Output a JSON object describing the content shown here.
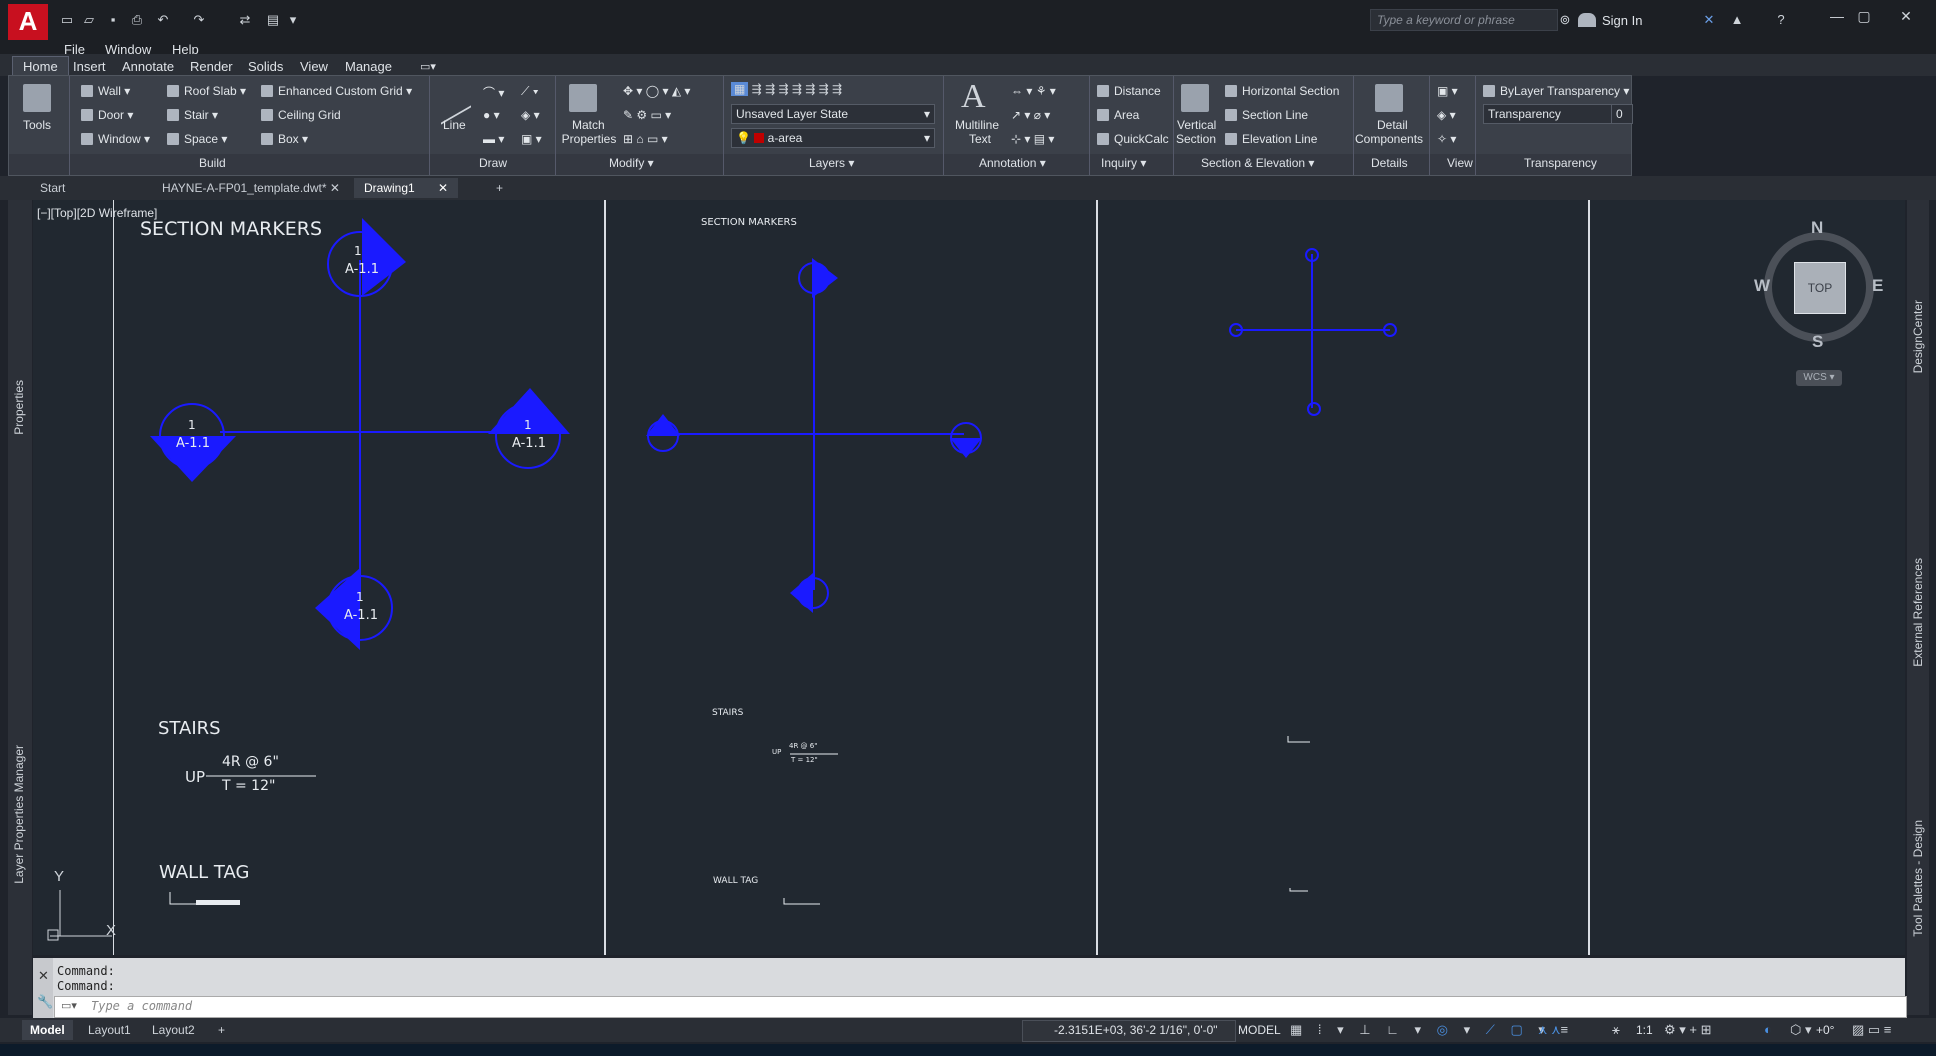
{
  "app": {
    "logo_letter": "A"
  },
  "search": {
    "placeholder": "Type a keyword or phrase"
  },
  "sign_in": "Sign In",
  "menus": [
    "File",
    "Window",
    "Help"
  ],
  "ribbon_tabs": [
    "Home",
    "Insert",
    "Annotate",
    "Render",
    "Solids",
    "View",
    "Manage"
  ],
  "ribbon": {
    "tools": "Tools",
    "build": {
      "title": "Build",
      "items": [
        "Wall",
        "Door",
        "Window",
        "Roof Slab",
        "Stair",
        "Space",
        "Enhanced Custom Grid",
        "Ceiling Grid",
        "Box"
      ]
    },
    "draw": {
      "title": "Draw",
      "line": "Line"
    },
    "modify": {
      "title": "Modify",
      "match": "Match",
      "properties": "Properties"
    },
    "layers": {
      "title": "Layers",
      "layer_state": "Unsaved Layer State",
      "current_layer": "a-area"
    },
    "annotation": {
      "title": "Annotation",
      "multiline": "Multiline",
      "text": "Text"
    },
    "inquiry": {
      "title": "Inquiry",
      "items": [
        "Distance",
        "Area",
        "QuickCalc"
      ]
    },
    "section": {
      "title": "Section & Elevation",
      "vertical": "Vertical",
      "section": "Section",
      "items": [
        "Horizontal Section",
        "Section Line",
        "Elevation Line"
      ]
    },
    "details": {
      "title": "Details",
      "detail": "Detail",
      "components": "Components"
    },
    "view": {
      "title": "View"
    },
    "transparency": {
      "title": "Transparency",
      "bylayer": "ByLayer Transparency",
      "label": "Transparency",
      "value": "0"
    }
  },
  "file_tabs": [
    "Start",
    "HAYNE-A-FP01_template.dwt*",
    "Drawing1"
  ],
  "viewport_label": "[−][Top][2D Wireframe]",
  "side_palettes": {
    "left": [
      "Properties",
      "Layer Properties Manager"
    ],
    "right": [
      "DesignCenter",
      "External References",
      "Tool Palettes - Design"
    ]
  },
  "drawing": {
    "section_markers": "SECTION MARKERS",
    "marker_num": "1",
    "marker_sheet": "A-1.1",
    "stairs": "STAIRS",
    "stair_up": "UP",
    "stair_riser": "4R @ 6\"",
    "stair_tread": "T = 12\"",
    "wall_tag": "WALL TAG"
  },
  "viewcube": {
    "n": "N",
    "s": "S",
    "e": "E",
    "w": "W",
    "top": "TOP",
    "wcs": "WCS"
  },
  "ucs": {
    "x": "X",
    "y": "Y"
  },
  "command": {
    "history": [
      "Command:",
      "Command:"
    ],
    "placeholder": "Type  a  command"
  },
  "layout_tabs": [
    "Model",
    "Layout1",
    "Layout2"
  ],
  "status": {
    "coords": "-2.3151E+03, 36'-2 1/16\", 0'-0\"",
    "mode": "MODEL",
    "scale": "1:1",
    "angle": "+0°"
  },
  "colors": {
    "marker": "#1a1aff",
    "background": "#212830",
    "accent": "#c8101f"
  }
}
